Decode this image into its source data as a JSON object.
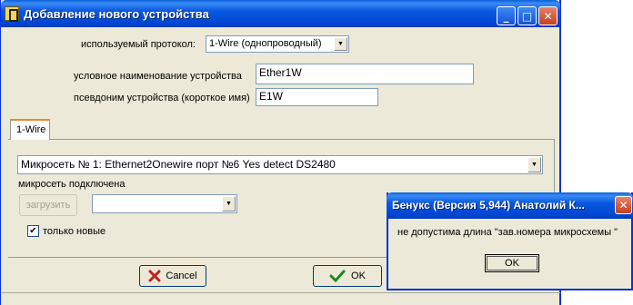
{
  "window": {
    "title": "Добавление нового устройства",
    "minimize_glyph": "_",
    "maximize_glyph": "□",
    "close_glyph": "✕"
  },
  "form": {
    "protocol_label": "используемый протокол:",
    "protocol_value": "1-Wire (однопроводный)",
    "device_name_label": "условное наименование устройства",
    "device_name_value": "Ether1W",
    "alias_label": "псевдоним устройства (короткое имя)",
    "alias_value": "E1W"
  },
  "tabs": [
    {
      "label": "1-Wire"
    }
  ],
  "onewire": {
    "network_value": "Микросеть № 1:   Ethernet2Onewire порт №6 Yes detect DS2480",
    "network_status": "микросеть подключена",
    "load_button": "загрузить",
    "load_select_value": "",
    "only_new_label": "только новые",
    "only_new_checked": true
  },
  "footer": {
    "cancel_label": "Cancel",
    "ok_label": "OK"
  },
  "dialog": {
    "title": "Бенукс (Версия 5,944) Анатолий К...",
    "message": "не допустима длина \"зав.номера микросхемы \"",
    "ok_label": "OK",
    "close_glyph": "✕"
  },
  "colors": {
    "titlebar": "#0054e3",
    "window_bg": "#ece9d8",
    "cancel_icon": "#c0201c",
    "ok_icon": "#1d8a1d"
  }
}
